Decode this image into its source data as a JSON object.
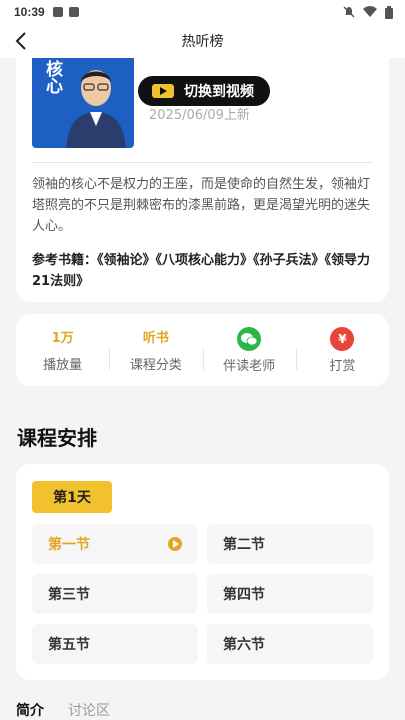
{
  "status": {
    "time": "10:39"
  },
  "nav": {
    "title": "热听榜"
  },
  "course": {
    "cover_text": "核心",
    "switch_label": "切换到视频",
    "date": "2025/06/09上新",
    "description": "领袖的核心不是权力的王座，而是使命的自然生发，领袖灯塔照亮的不只是荆棘密布的漆黑前路，更是渴望光明的迷失人心。",
    "references": "参考书籍：《领袖论》《八项核心能力》《孙子兵法》《领导力21法则》"
  },
  "stats": [
    {
      "value": "1万",
      "label": "播放量"
    },
    {
      "value": "听书",
      "label": "课程分类"
    },
    {
      "icon": "wechat-icon",
      "label": "伴读老师"
    },
    {
      "icon": "money-bag-icon",
      "label": "打赏"
    }
  ],
  "schedule": {
    "title": "课程安排",
    "day": "第1天",
    "lessons": [
      "第一节",
      "第二节",
      "第三节",
      "第四节",
      "第五节",
      "第六节"
    ],
    "active_index": 0
  },
  "tabs": {
    "intro": "简介",
    "discussion": "讨论区"
  },
  "colors": {
    "accent": "#f2c12e",
    "accent_text": "#e0a626",
    "wechat": "#2bb748",
    "reward": "#e8443a"
  }
}
